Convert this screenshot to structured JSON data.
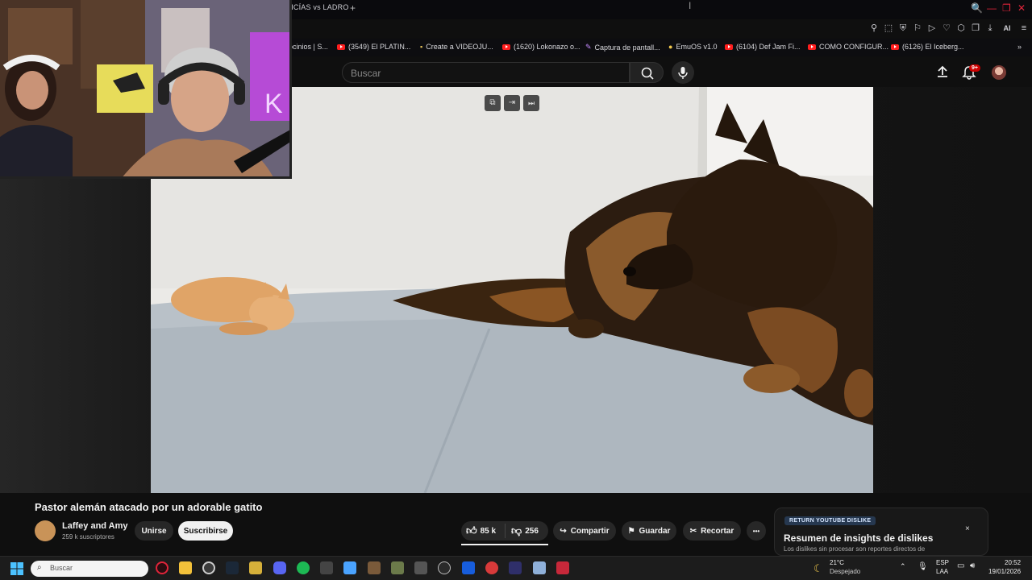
{
  "browser": {
    "tab_label": "LICÍAS vs LADRO",
    "new_tab_symbol": "+",
    "window_controls": [
      "🔍",
      "—",
      "❐",
      "✕"
    ],
    "toolbar_ai_label": "AI",
    "bookmarks": [
      {
        "label": "ocinios | S..."
      },
      {
        "label": "(3549) El PLATIN..."
      },
      {
        "label": "Create a VIDEOJU..."
      },
      {
        "label": "(1620) Lokonazo o..."
      },
      {
        "label": "Captura de pantall..."
      },
      {
        "label": "EmuOS v1.0"
      },
      {
        "label": "(6104) Def Jam Fi..."
      },
      {
        "label": "COMO CONFIGUR..."
      },
      {
        "label": "(6126) El Iceberg..."
      }
    ]
  },
  "youtube": {
    "search_placeholder": "Buscar",
    "notification_badge": "9+",
    "video_title": "Pastor alemán atacado por un adorable gatito",
    "channel_name": "Laffey and Amy",
    "channel_subs": "259 k suscriptores",
    "join_label": "Unirse",
    "subscribe_label": "Suscribirse",
    "likes": "85 k",
    "dislikes": "256",
    "share_label": "Compartir",
    "save_label": "Guardar",
    "clip_label": "Recortar",
    "more_label": "•••"
  },
  "ryd_panel": {
    "badge": "RETURN YOUTUBE DISLIKE",
    "heading": "Resumen de insights de dislikes",
    "description": "Los dislikes sin procesar son reportes directos de",
    "close": "×"
  },
  "taskbar": {
    "search_placeholder": "Buscar",
    "temperature": "21°C",
    "weather": "Despejado",
    "lang_top": "ESP",
    "lang_bottom": "LAA",
    "time": "20:52",
    "date": "19/01/2026"
  },
  "colors": {
    "accent_red": "#e0243a",
    "yt_red": "#ff0000",
    "bg": "#0f0f0f"
  }
}
